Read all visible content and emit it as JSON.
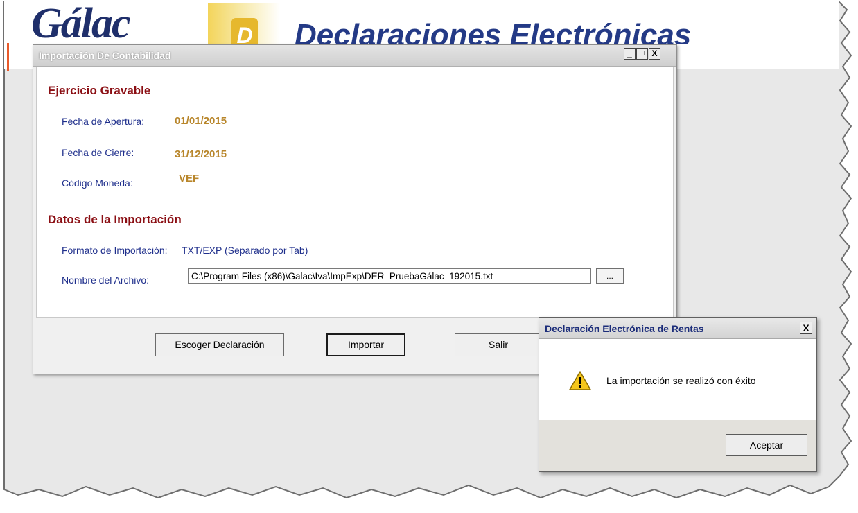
{
  "banner": {
    "logo": "Gálac",
    "d_badge": "D",
    "product_title": "Declaraciones Electrónicas"
  },
  "main_window": {
    "title": "Importación De Contabilidad",
    "controls": {
      "minimize": "_",
      "maximize": "□",
      "close": "X"
    },
    "section_fiscal_year": {
      "title": "Ejercicio Gravable",
      "opening_label": "Fecha de Apertura:",
      "opening_value": "01/01/2015",
      "closing_label": "Fecha de Cierre:",
      "closing_value": "31/12/2015",
      "currency_label": "Código Moneda:",
      "currency_value": "VEF"
    },
    "section_import": {
      "title": "Datos de la Importación",
      "format_label": "Formato de Importación:",
      "format_value": "TXT/EXP (Separado por Tab)",
      "file_label": "Nombre del Archivo:",
      "file_value": "C:\\Program Files (x86)\\Galac\\Iva\\ImpExp\\DER_PruebaGálac_192015.txt",
      "browse_label": "..."
    },
    "buttons": {
      "choose": "Escoger Declaración",
      "import": "Importar",
      "exit": "Salir"
    }
  },
  "message_box": {
    "title": "Declaración Electrónica de Rentas",
    "close": "X",
    "message": "La importación se realizó con éxito",
    "icon": "warning-icon",
    "ok": "Aceptar"
  },
  "colors": {
    "section_title": "#8b0f14",
    "label": "#1f2f8c",
    "value": "#b8862b"
  }
}
